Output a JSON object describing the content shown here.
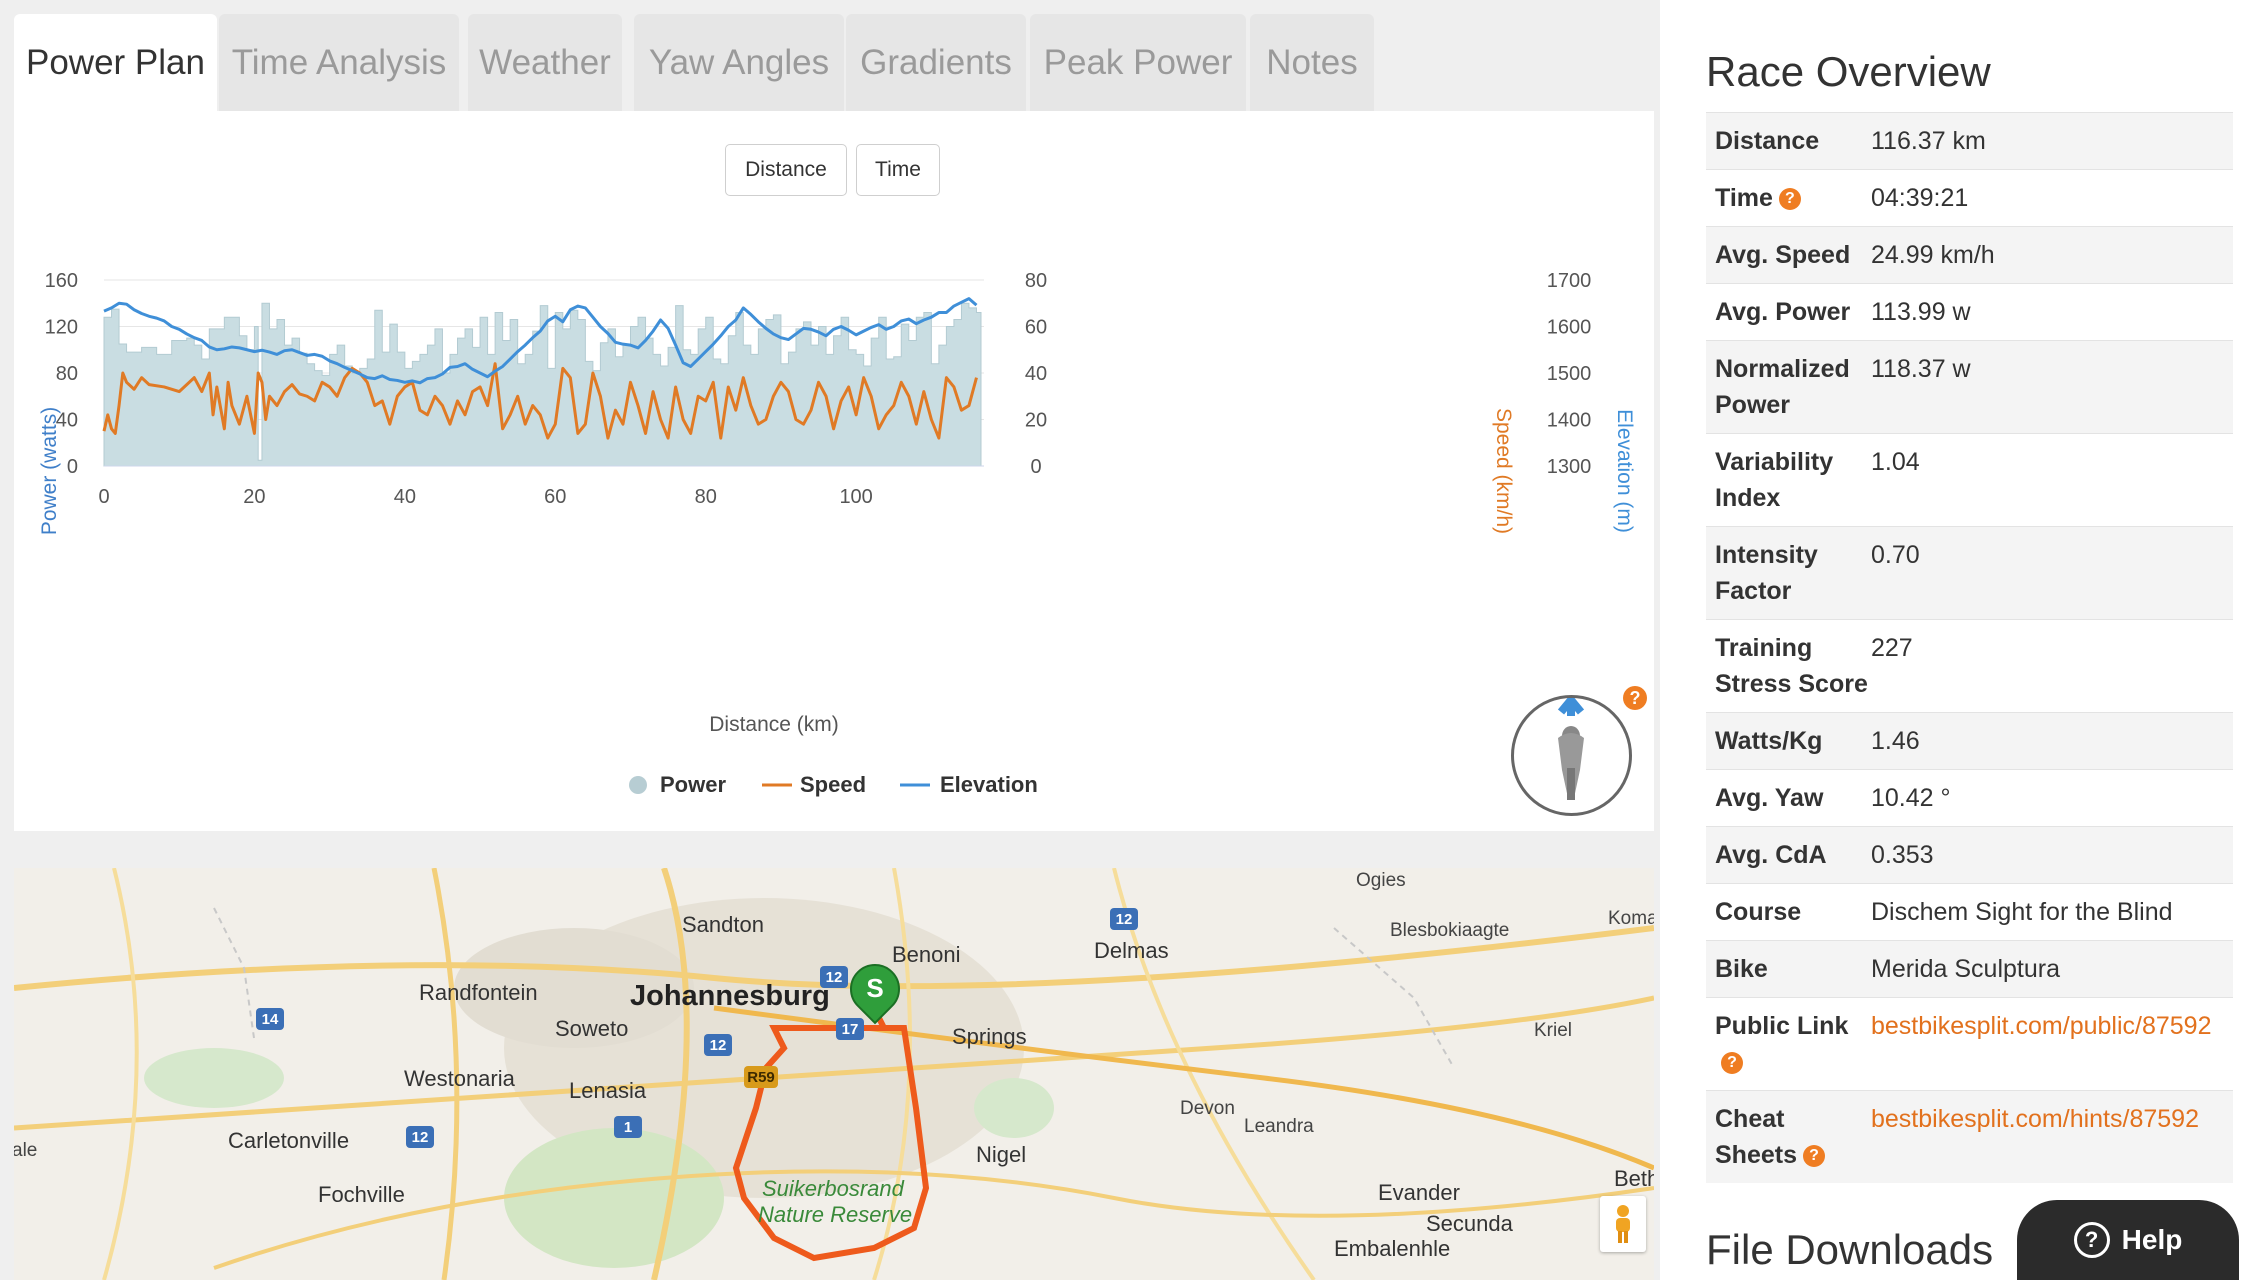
{
  "tabs": [
    {
      "label": "Power Plan",
      "active": true
    },
    {
      "label": "Time Analysis",
      "active": false
    },
    {
      "label": "Weather",
      "active": false
    },
    {
      "label": "Yaw Angles",
      "active": false
    },
    {
      "label": "Gradients",
      "active": false
    },
    {
      "label": "Peak Power",
      "active": false
    },
    {
      "label": "Notes",
      "active": false
    }
  ],
  "chart_controls": {
    "distance_label": "Distance",
    "time_label": "Time"
  },
  "chart_data": {
    "type": "line",
    "xlabel": "Distance (km)",
    "xlim": [
      0,
      117
    ],
    "xticks": [
      0,
      20,
      40,
      60,
      80,
      100
    ],
    "axes": {
      "power": {
        "label": "Power (watts)",
        "range": [
          0,
          160
        ],
        "ticks": [
          0,
          40,
          80,
          120,
          160
        ],
        "color": "#3f7fc9"
      },
      "speed": {
        "label": "Speed (km/h)",
        "range": [
          0,
          80
        ],
        "ticks": [
          0,
          20,
          40,
          60,
          80
        ],
        "color": "#e07a25"
      },
      "elevation": {
        "label": "Elevation (m)",
        "range": [
          1300,
          1700
        ],
        "ticks": [
          1300,
          1400,
          1500,
          1600,
          1700
        ],
        "color": "#3f8fd8"
      }
    },
    "legend": [
      "Power",
      "Speed",
      "Elevation"
    ],
    "series": [
      {
        "name": "Power",
        "kind": "area",
        "axis": "power",
        "color": "#c9dde2",
        "x": [
          0,
          1,
          2,
          3,
          5,
          7,
          9,
          11,
          12,
          13,
          14,
          16,
          18,
          19,
          20,
          20.5,
          21,
          22,
          23,
          24,
          25,
          26,
          27,
          28,
          29,
          30,
          31,
          32,
          33,
          34,
          35,
          36,
          37,
          38,
          39,
          40,
          41,
          42,
          43,
          44,
          45,
          46,
          47,
          48,
          49,
          50,
          51,
          52,
          53,
          54,
          55,
          56,
          57,
          58,
          59,
          60,
          61,
          62,
          63,
          64,
          65,
          66,
          67,
          68,
          69,
          70,
          71,
          72,
          73,
          74,
          75,
          76,
          77,
          78,
          79,
          80,
          81,
          82,
          83,
          84,
          85,
          86,
          87,
          88,
          89,
          90,
          91,
          92,
          93,
          94,
          95,
          96,
          97,
          98,
          99,
          100,
          101,
          102,
          103,
          104,
          105,
          106,
          107,
          108,
          109,
          110,
          111,
          112,
          113,
          114,
          115,
          116
        ],
        "values": [
          128,
          135,
          105,
          98,
          102,
          96,
          108,
          110,
          104,
          92,
          118,
          128,
          112,
          100,
          120,
          5,
          140,
          118,
          126,
          104,
          110,
          97,
          88,
          82,
          78,
          96,
          104,
          86,
          80,
          84,
          92,
          134,
          98,
          122,
          98,
          84,
          90,
          96,
          104,
          118,
          80,
          96,
          110,
          118,
          102,
          128,
          96,
          132,
          108,
          126,
          88,
          96,
          116,
          138,
          84,
          132,
          118,
          134,
          126,
          90,
          82,
          106,
          118,
          94,
          104,
          120,
          128,
          110,
          96,
          86,
          102,
          138,
          100,
          96,
          118,
          128,
          92,
          88,
          112,
          132,
          104,
          96,
          118,
          126,
          130,
          88,
          98,
          118,
          124,
          104,
          120,
          96,
          112,
          128,
          100,
          96,
          86,
          110,
          128,
          92,
          94,
          122,
          108,
          128,
          132,
          88,
          104,
          120,
          126,
          140,
          136,
          132
        ]
      },
      {
        "name": "Speed",
        "kind": "line",
        "axis": "speed",
        "color": "#e07a25",
        "x": [
          0,
          0.5,
          1,
          1.5,
          2,
          2.5,
          3,
          4,
          5,
          6,
          8,
          10,
          12,
          13,
          14,
          14.5,
          15,
          16,
          16.5,
          17,
          18,
          19,
          20,
          20.5,
          21,
          21.5,
          22,
          23,
          24,
          25,
          26,
          27,
          28,
          29,
          30,
          31,
          32,
          33,
          34,
          35,
          36,
          37,
          38,
          39,
          40,
          41,
          42,
          43,
          44,
          45,
          46,
          47,
          48,
          49,
          50,
          51,
          52,
          53,
          54,
          55,
          56,
          57,
          58,
          59,
          60,
          61,
          62,
          63,
          64,
          65,
          66,
          67,
          68,
          69,
          70,
          71,
          72,
          73,
          74,
          75,
          76,
          77,
          78,
          79,
          80,
          81,
          82,
          83,
          84,
          85,
          86,
          87,
          88,
          89,
          90,
          91,
          92,
          93,
          94,
          95,
          96,
          97,
          98,
          99,
          100,
          101,
          102,
          103,
          104,
          105,
          106,
          107,
          108,
          109,
          110,
          111,
          112,
          113,
          114,
          115,
          116
        ],
        "values": [
          15,
          22,
          16,
          14,
          26,
          40,
          36,
          33,
          38,
          35,
          34,
          32,
          38,
          32,
          40,
          22,
          34,
          16,
          36,
          26,
          18,
          30,
          14,
          40,
          36,
          20,
          30,
          26,
          32,
          35,
          31,
          30,
          28,
          36,
          34,
          30,
          38,
          42,
          40,
          36,
          26,
          28,
          18,
          30,
          34,
          36,
          24,
          22,
          30,
          26,
          18,
          28,
          22,
          32,
          34,
          26,
          44,
          16,
          22,
          30,
          18,
          26,
          22,
          12,
          18,
          42,
          38,
          14,
          18,
          40,
          30,
          12,
          24,
          18,
          36,
          26,
          14,
          32,
          20,
          12,
          34,
          20,
          14,
          30,
          28,
          36,
          12,
          34,
          24,
          38,
          26,
          18,
          20,
          30,
          36,
          32,
          20,
          18,
          24,
          36,
          30,
          16,
          28,
          34,
          22,
          38,
          30,
          16,
          22,
          26,
          36,
          30,
          18,
          32,
          20,
          12,
          38,
          34,
          24,
          26,
          38
        ]
      },
      {
        "name": "Elevation",
        "kind": "line",
        "axis": "elevation",
        "color": "#3f8fd8",
        "x": [
          0,
          1,
          2,
          3,
          4,
          5,
          6,
          7,
          8,
          9,
          10,
          11,
          12,
          13,
          14,
          15,
          16,
          17,
          18,
          19,
          20,
          21,
          22,
          23,
          24,
          25,
          26,
          27,
          28,
          29,
          30,
          31,
          32,
          33,
          34,
          35,
          36,
          37,
          38,
          39,
          40,
          41,
          42,
          43,
          44,
          45,
          46,
          47,
          48,
          49,
          50,
          51,
          52,
          53,
          54,
          55,
          56,
          57,
          58,
          59,
          60,
          61,
          62,
          63,
          64,
          65,
          66,
          67,
          68,
          69,
          70,
          71,
          72,
          73,
          74,
          75,
          76,
          77,
          78,
          79,
          80,
          81,
          82,
          83,
          84,
          85,
          86,
          87,
          88,
          89,
          90,
          91,
          92,
          93,
          94,
          95,
          96,
          97,
          98,
          99,
          100,
          101,
          102,
          103,
          104,
          105,
          106,
          107,
          108,
          109,
          110,
          111,
          112,
          113,
          114,
          115,
          116
        ],
        "values": [
          1633,
          1640,
          1650,
          1648,
          1636,
          1628,
          1622,
          1618,
          1612,
          1600,
          1594,
          1584,
          1576,
          1570,
          1556,
          1550,
          1552,
          1556,
          1554,
          1550,
          1546,
          1549,
          1545,
          1540,
          1548,
          1550,
          1544,
          1538,
          1540,
          1536,
          1526,
          1520,
          1512,
          1505,
          1498,
          1490,
          1488,
          1494,
          1486,
          1484,
          1480,
          1483,
          1479,
          1488,
          1490,
          1498,
          1512,
          1514,
          1520,
          1508,
          1500,
          1492,
          1504,
          1514,
          1530,
          1546,
          1560,
          1576,
          1590,
          1612,
          1622,
          1610,
          1636,
          1644,
          1640,
          1620,
          1600,
          1585,
          1566,
          1562,
          1560,
          1554,
          1570,
          1590,
          1614,
          1596,
          1560,
          1522,
          1514,
          1530,
          1546,
          1562,
          1580,
          1600,
          1614,
          1640,
          1626,
          1610,
          1596,
          1584,
          1576,
          1572,
          1584,
          1596,
          1594,
          1588,
          1580,
          1594,
          1600,
          1592,
          1582,
          1590,
          1598,
          1604,
          1594,
          1600,
          1612,
          1616,
          1606,
          1614,
          1620,
          1630,
          1630,
          1644,
          1652,
          1660,
          1646
        ]
      }
    ]
  },
  "map": {
    "labels": [
      {
        "text": "Sandton",
        "size": "normal"
      },
      {
        "text": "Benoni",
        "size": "normal"
      },
      {
        "text": "Delmas",
        "size": "normal"
      },
      {
        "text": "Ogies",
        "size": "small"
      },
      {
        "text": "Blesbokiaagte",
        "size": "small"
      },
      {
        "text": "Koma",
        "size": "small"
      },
      {
        "text": "Randfontein",
        "size": "normal"
      },
      {
        "text": "Johannesburg",
        "size": "big"
      },
      {
        "text": "Soweto",
        "size": "normal"
      },
      {
        "text": "Springs",
        "size": "normal"
      },
      {
        "text": "Kriel",
        "size": "small"
      },
      {
        "text": "Westonaria",
        "size": "normal"
      },
      {
        "text": "Lenasia",
        "size": "normal"
      },
      {
        "text": "Devon",
        "size": "small"
      },
      {
        "text": "Leandra",
        "size": "small"
      },
      {
        "text": "Carletonville",
        "size": "normal"
      },
      {
        "text": "Nigel",
        "size": "normal"
      },
      {
        "text": "Suikerbosrand",
        "size": "park"
      },
      {
        "text": "Nature Reserve",
        "size": "park"
      },
      {
        "text": "Fochville",
        "size": "normal"
      },
      {
        "text": "Evander",
        "size": "normal"
      },
      {
        "text": "Secunda",
        "size": "normal"
      },
      {
        "text": "Embalenhle",
        "size": "normal"
      },
      {
        "text": "Beth",
        "size": "normal"
      },
      {
        "text": "ale",
        "size": "small"
      }
    ],
    "shields": [
      "14",
      "12",
      "12",
      "17",
      "12",
      "R59",
      "1",
      "12",
      "12"
    ],
    "start_marker": "S",
    "route_color": "#ee5a1c"
  },
  "overview": {
    "title": "Race Overview",
    "rows": [
      {
        "label": "Distance",
        "value": "116.37 km"
      },
      {
        "label": "Time",
        "value": "04:39:21",
        "help": "?"
      },
      {
        "label": "Avg. Speed",
        "value": "24.99 km/h"
      },
      {
        "label": "Avg. Power",
        "value": "113.99 w"
      },
      {
        "label": "Normalized Power",
        "value": "118.37 w"
      },
      {
        "label": "Variability Index",
        "value": "1.04"
      },
      {
        "label": "Intensity Factor",
        "value": "0.70"
      },
      {
        "label": "Training Stress Score",
        "value": "227"
      },
      {
        "label": "Watts/Kg",
        "value": "1.46"
      },
      {
        "label": "Avg. Yaw",
        "value": "10.42 °"
      },
      {
        "label": "Avg. CdA",
        "value": "0.353"
      },
      {
        "label": "Course",
        "value": "Dischem Sight for the Blind"
      },
      {
        "label": "Bike",
        "value": "Merida Sculptura"
      },
      {
        "label": "Public Link",
        "value": "bestbikesplit.com/public/87592",
        "link": true,
        "help": "?"
      },
      {
        "label": "Cheat Sheets",
        "value": "bestbikesplit.com/hints/87592",
        "link": true,
        "help": "?"
      }
    ]
  },
  "downloads": {
    "title": "File Downloads"
  },
  "help_button": {
    "label": "Help",
    "icon": "?"
  },
  "chart_help": "?",
  "colors": {
    "accent": "#ef7d22",
    "power_fill": "#c9dde2",
    "speed": "#e07a25",
    "elevation": "#3f8fd8"
  }
}
